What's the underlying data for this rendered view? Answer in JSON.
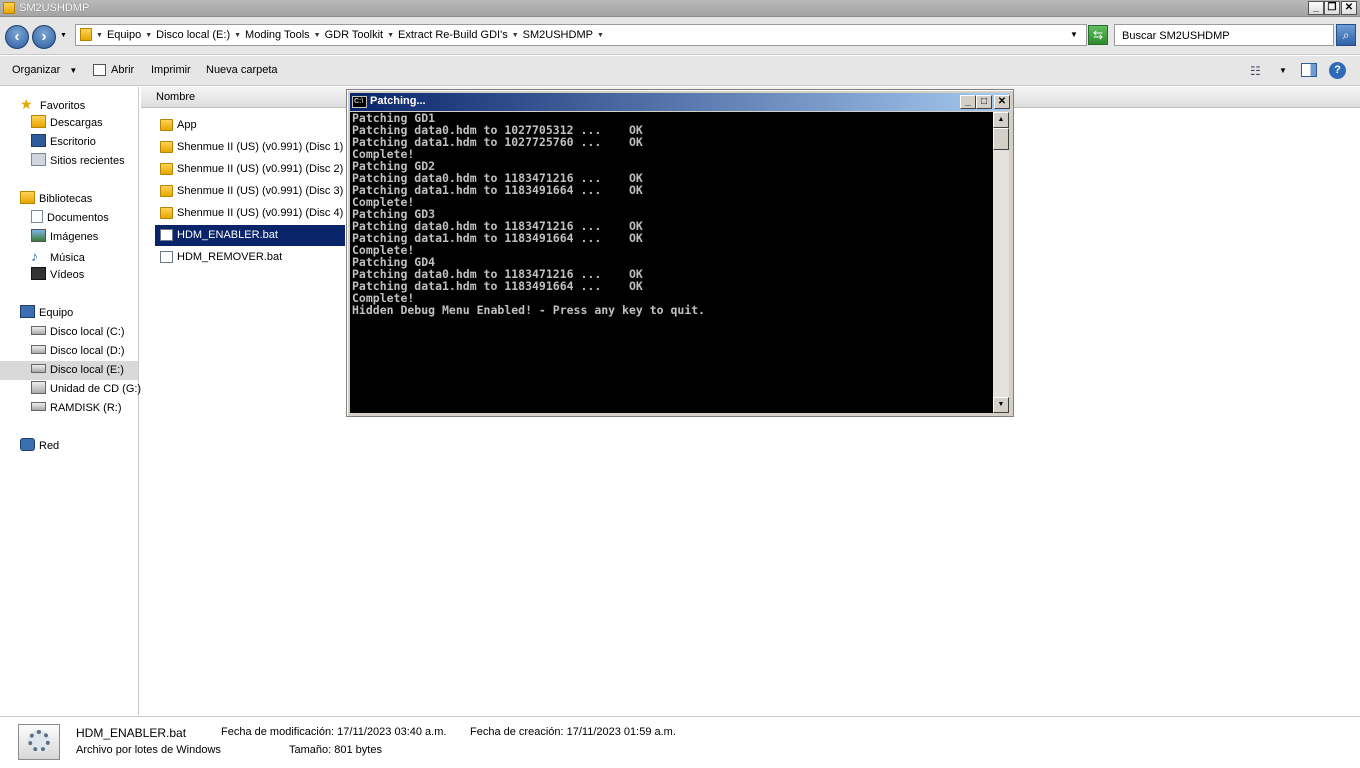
{
  "window": {
    "title": "SM2USHDMP"
  },
  "nav_buttons": {
    "back": "‹",
    "forward": "›"
  },
  "address": {
    "crumbs": [
      "Equipo",
      "Disco local (E:)",
      "Moding Tools",
      "GDR Toolkit",
      "Extract Re-Build GDI's",
      "SM2USHDMP"
    ]
  },
  "search": {
    "placeholder": "Buscar SM2USHDMP"
  },
  "toolbar": {
    "organize": "Organizar",
    "open": "Abrir",
    "print": "Imprimir",
    "new_folder": "Nueva carpeta"
  },
  "sidebar": {
    "favorites": {
      "label": "Favoritos",
      "items": [
        "Descargas",
        "Escritorio",
        "Sitios recientes"
      ]
    },
    "libraries": {
      "label": "Bibliotecas",
      "items": [
        "Documentos",
        "Imágenes",
        "Música",
        "Vídeos"
      ]
    },
    "computer": {
      "label": "Equipo",
      "items": [
        "Disco local (C:)",
        "Disco local (D:)",
        "Disco local (E:)",
        "Unidad de CD (G:)",
        "RAMDISK (R:)"
      ]
    },
    "network": {
      "label": "Red"
    }
  },
  "columns": {
    "name": "Nombre"
  },
  "files": [
    {
      "name": "App",
      "type": "folder"
    },
    {
      "name": "Shenmue II (US) (v0.991) (Disc 1)",
      "type": "folder"
    },
    {
      "name": "Shenmue II (US) (v0.991) (Disc 2)",
      "type": "folder"
    },
    {
      "name": "Shenmue II (US) (v0.991) (Disc 3)",
      "type": "folder"
    },
    {
      "name": "Shenmue II (US) (v0.991) (Disc 4)",
      "type": "folder"
    },
    {
      "name": "HDM_ENABLER.bat",
      "type": "bat",
      "selected": true
    },
    {
      "name": "HDM_REMOVER.bat",
      "type": "bat"
    }
  ],
  "console": {
    "title": "Patching...",
    "lines": [
      "Patching GD1",
      "Patching data0.hdm to 1027705312 ...    OK",
      "Patching data1.hdm to 1027725760 ...    OK",
      "Complete!",
      "Patching GD2",
      "Patching data0.hdm to 1183471216 ...    OK",
      "Patching data1.hdm to 1183491664 ...    OK",
      "Complete!",
      "Patching GD3",
      "Patching data0.hdm to 1183471216 ...    OK",
      "Patching data1.hdm to 1183491664 ...    OK",
      "Complete!",
      "Patching GD4",
      "Patching data0.hdm to 1183471216 ...    OK",
      "Patching data1.hdm to 1183491664 ...    OK",
      "Complete!",
      "Hidden Debug Menu Enabled! - Press any key to quit."
    ]
  },
  "status": {
    "file_name": "HDM_ENABLER.bat",
    "file_type": "Archivo por lotes de Windows",
    "modified": "Fecha de modificación: 17/11/2023 03:40 a.m.",
    "size": "Tamaño: 801 bytes",
    "created": "Fecha de creación: 17/11/2023 01:59 a.m."
  }
}
